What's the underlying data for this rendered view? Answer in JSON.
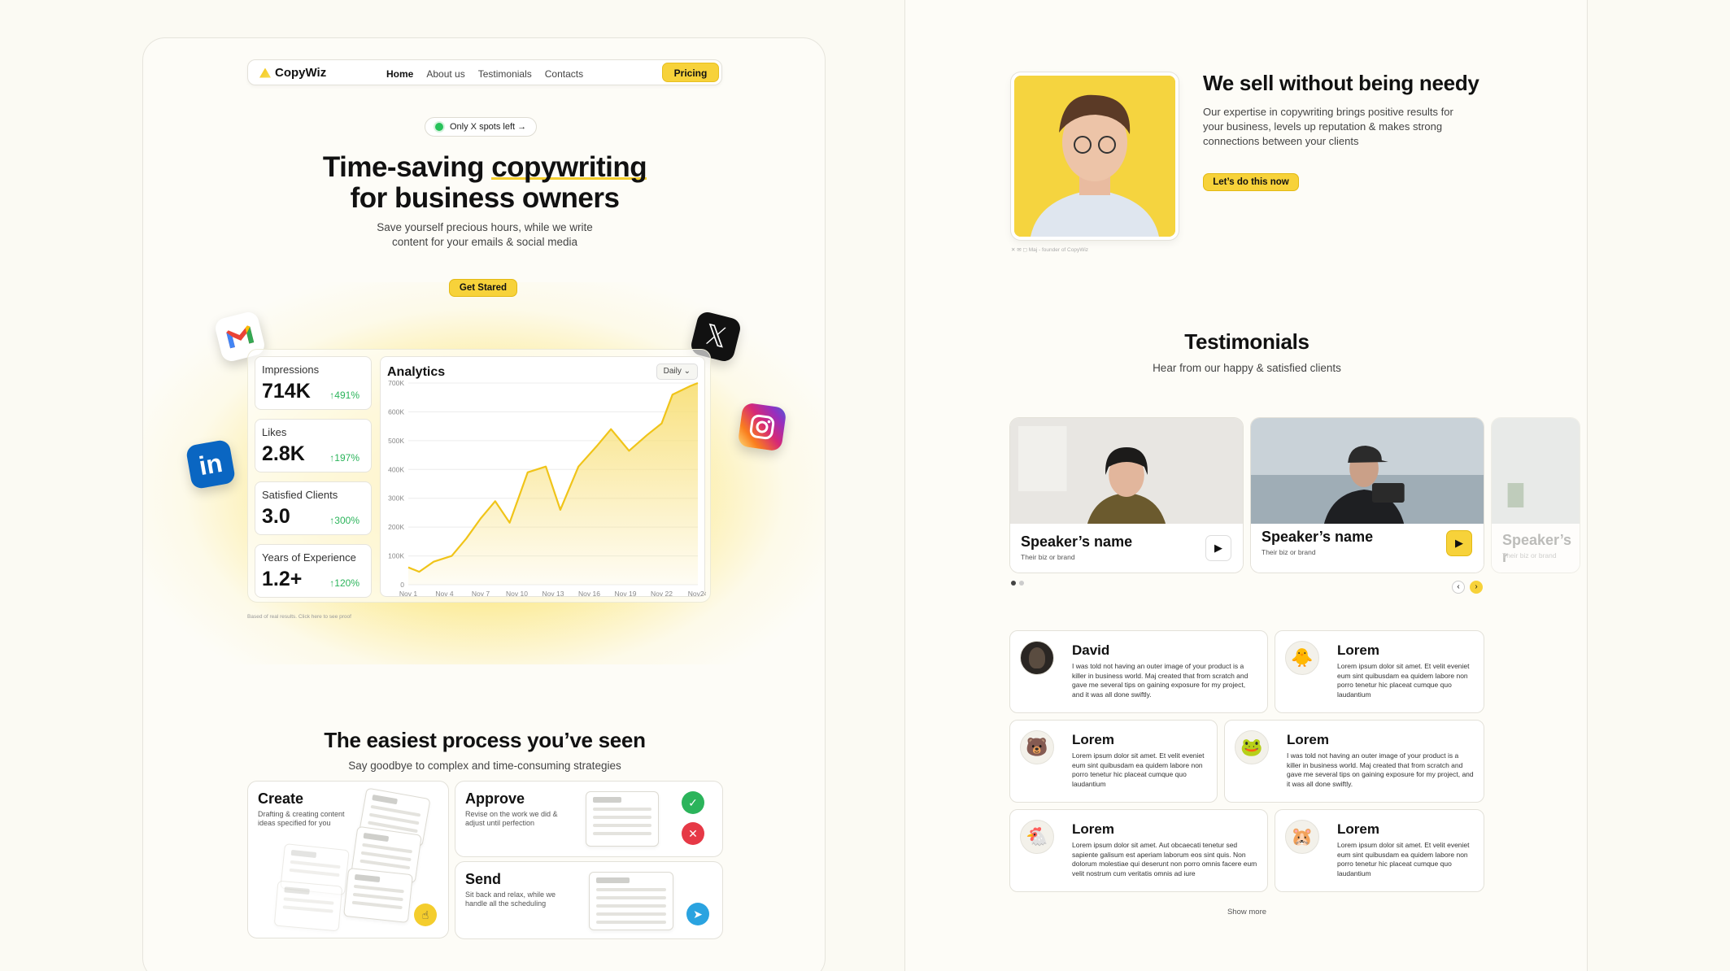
{
  "nav": {
    "brand": "CopyWiz",
    "links": [
      "Home",
      "About us",
      "Testimonials",
      "Contacts"
    ],
    "pricing": "Pricing"
  },
  "hero": {
    "badge": "Only X spots left →",
    "title_line1_prefix": "Time-saving ",
    "title_line1_highlight": "copywriting",
    "title_line2": "for business owners",
    "subtitle": "Save yourself precious hours, while we write content for your emails & social media",
    "cta": "Get Stared"
  },
  "stats": [
    {
      "label": "Impressions",
      "value": "714K",
      "change": "↑491%"
    },
    {
      "label": "Likes",
      "value": "2.8K",
      "change": "↑197%"
    },
    {
      "label": "Satisfied Clients",
      "value": "3.0",
      "change": "↑300%"
    },
    {
      "label": "Years of Experience",
      "value": "1.2+",
      "change": "↑120%"
    }
  ],
  "analytics": {
    "title": "Analytics",
    "period": "Daily"
  },
  "chart_data": {
    "type": "area",
    "title": "Analytics",
    "x": [
      "Nov 1",
      "Nov 4",
      "Nov 7",
      "Nov 10",
      "Nov 13",
      "Nov 16",
      "Nov 19",
      "Nov 22",
      "Nov24"
    ],
    "y_ticks": [
      "0",
      "100K",
      "200K",
      "300K",
      "400K",
      "500K",
      "600K",
      "700K"
    ],
    "ylim": [
      0,
      700000
    ],
    "series": [
      {
        "points": [
          [
            0,
            60000
          ],
          [
            0.3,
            45000
          ],
          [
            0.7,
            80000
          ],
          [
            1.2,
            100000
          ],
          [
            1.6,
            160000
          ],
          [
            2.0,
            230000
          ],
          [
            2.4,
            290000
          ],
          [
            2.8,
            215000
          ],
          [
            3.3,
            390000
          ],
          [
            3.8,
            410000
          ],
          [
            4.2,
            260000
          ],
          [
            4.7,
            410000
          ],
          [
            5.2,
            480000
          ],
          [
            5.6,
            540000
          ],
          [
            6.1,
            465000
          ],
          [
            6.6,
            520000
          ],
          [
            7.0,
            560000
          ],
          [
            7.3,
            660000
          ],
          [
            7.8,
            690000
          ],
          [
            8.0,
            730000
          ]
        ]
      }
    ],
    "grid": true,
    "colors": {
      "line": "#f0c419",
      "fill": "#f8e07a"
    }
  },
  "note": "Based of real results. Click here to see proof",
  "process": {
    "title": "The easiest process you’ve seen",
    "subtitle": "Say goodbye to complex and time-consuming strategies",
    "create": {
      "title": "Create",
      "desc": "Drafting & creating content ideas specified for you"
    },
    "approve": {
      "title": "Approve",
      "desc": "Revise on the work we did & adjust until perfection"
    },
    "send": {
      "title": "Send",
      "desc": "Sit back and relax, while we handle all the scheduling"
    }
  },
  "about": {
    "title": "We sell without being needy",
    "text": "Our expertise in copywriting brings positive results for your business, levels up reputation & makes strong connections between your clients",
    "cta": "Let’s do this now",
    "caption": "Maj - founder of CopyWiz"
  },
  "testimonials": {
    "title": "Testimonials",
    "subtitle": "Hear from our happy & satisfied clients",
    "videos": [
      {
        "speaker": "Speaker’s name",
        "brand": "Their biz or brand"
      },
      {
        "speaker": "Speaker’s name",
        "brand": "Their biz or brand"
      },
      {
        "speaker": "Speaker’s r",
        "brand": "Their biz or brand"
      }
    ],
    "reviews": [
      {
        "name": "David",
        "text": "I was told not having an outer image of your product is a killer in business world. Maj created that from scratch and gave me several tips on gaining exposure for my project, and it was all done swiftly."
      },
      {
        "name": "Lorem",
        "text": "Lorem ipsum dolor sit amet. Et velit eveniet eum sint quibusdam ea quidem labore non porro tenetur hic placeat cumque quo laudantium"
      },
      {
        "name": "Lorem",
        "text": "Lorem ipsum dolor sit amet. Et velit eveniet eum sint quibusdam ea quidem labore non porro tenetur hic placeat cumque quo laudantium"
      },
      {
        "name": "Lorem",
        "text": "I was told not having an outer image of your product is a killer in business world. Maj created that from scratch and gave me several tips on gaining exposure for my project, and it was all done swiftly."
      },
      {
        "name": "Lorem",
        "text": "Lorem ipsum dolor sit amet. Aut obcaecati tenetur sed sapiente galisum est aperiam laborum eos sint quis. Non dolorum molestiae qui deserunt non porro omnis facere eum velit nostrum cum veritatis omnis ad iure"
      },
      {
        "name": "Lorem",
        "text": "Lorem ipsum dolor sit amet. Et velit eveniet eum sint quibusdam ea quidem labore non porro tenetur hic placeat cumque quo laudantium"
      }
    ],
    "show_more": "Show more"
  },
  "colors": {
    "accent": "#f7d23a",
    "success": "#2bb45b",
    "danger": "#e63946",
    "telegram": "#2aa3e0"
  }
}
